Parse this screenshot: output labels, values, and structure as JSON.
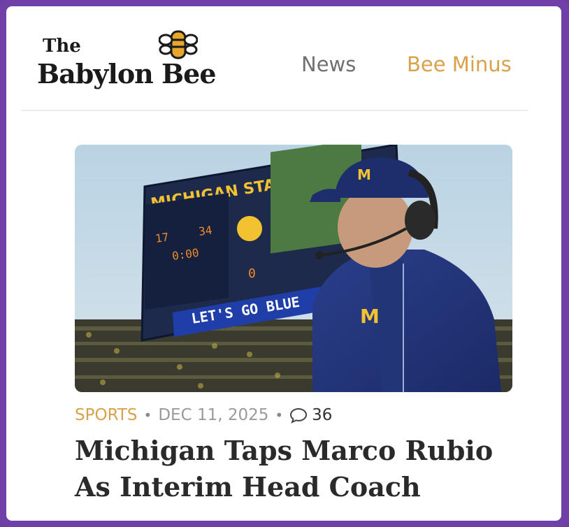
{
  "brand": {
    "the": "The",
    "name": "Babylon Bee",
    "logo_icon": "bee-icon"
  },
  "nav": {
    "items": [
      {
        "label": "News",
        "color": "#707070"
      },
      {
        "label": "Bee Minus",
        "color": "#d8a24a"
      }
    ]
  },
  "hero": {
    "scoreboard_header": "MICHIGAN STADIUM",
    "banner": "LET'S GO BLUE",
    "score_home": "17",
    "score_away": "34",
    "clock": "0:00",
    "down": "0"
  },
  "article": {
    "section": "SPORTS",
    "date": "DEC 11, 2025",
    "comment_count": "36",
    "comment_icon": "comment-bubble-icon",
    "headline": "Michigan Taps Marco Rubio As Interim Head Coach"
  },
  "colors": {
    "frame": "#7040a8",
    "accent_gold": "#d8a24a",
    "michigan_blue": "#1e2d6b",
    "maize": "#f2c230"
  }
}
